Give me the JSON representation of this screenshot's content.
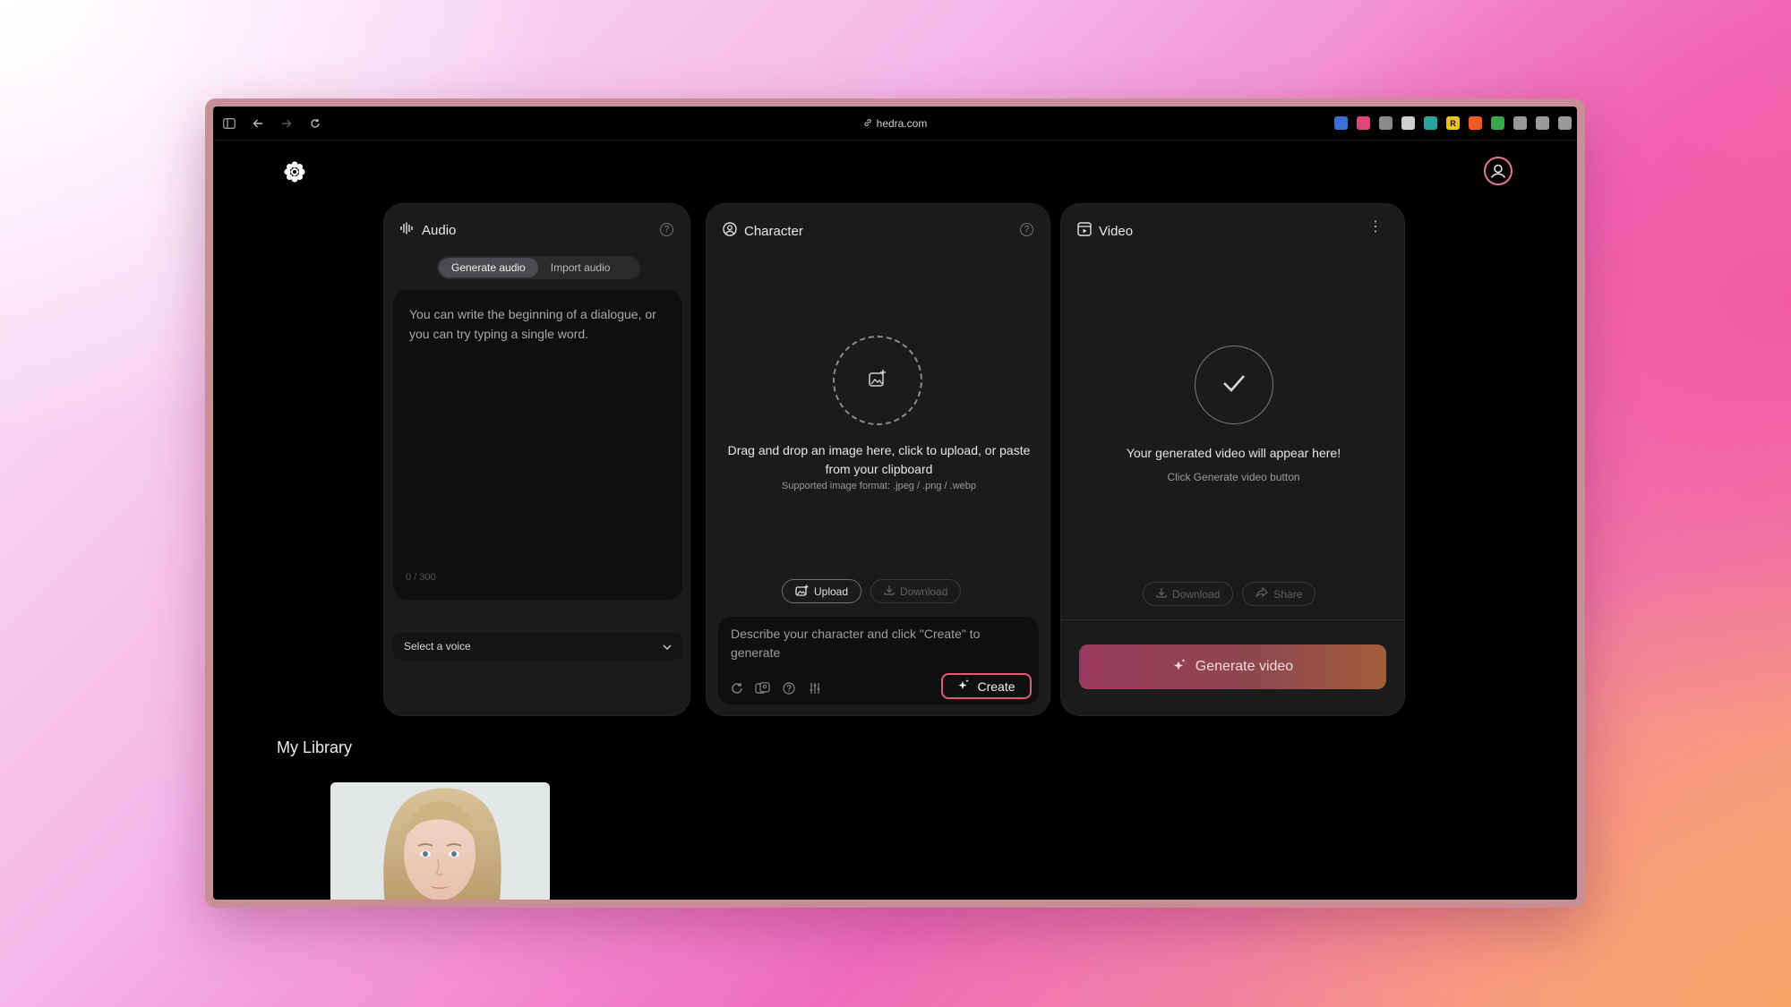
{
  "browser": {
    "url": "hedra.com",
    "extensions": [
      {
        "name": "ext-1",
        "label": "",
        "color": "#3a6fd8"
      },
      {
        "name": "ext-2",
        "label": "",
        "color": "#e0437a"
      },
      {
        "name": "ext-3",
        "label": "",
        "color": "#8a8a8a"
      },
      {
        "name": "ext-4",
        "label": "",
        "color": "#cfcfcf"
      },
      {
        "name": "ext-5",
        "label": "",
        "color": "#2aa3a0"
      },
      {
        "name": "ext-6",
        "label": "R",
        "color": "#e8c21f"
      },
      {
        "name": "ext-7",
        "label": "",
        "color": "#f05a24"
      },
      {
        "name": "ext-8",
        "label": "",
        "color": "#3aa64a"
      },
      {
        "name": "ext-9",
        "label": "",
        "color": "#9a9a9a"
      },
      {
        "name": "ext-10",
        "label": "",
        "color": "#9a9a9a"
      },
      {
        "name": "ext-11",
        "label": "",
        "color": "#9a9a9a"
      }
    ]
  },
  "audio": {
    "title": "Audio",
    "tab_generate": "Generate audio",
    "tab_import": "Import audio",
    "text_placeholder": "You can write the beginning of a dialogue, or you can try typing a single word.",
    "counter": "0 / 300",
    "voice_select": "Select a voice"
  },
  "character": {
    "title": "Character",
    "drop_text": "Drag and drop an image here, click to upload, or paste from your clipboard",
    "formats": "Supported image format: .jpeg / .png / .webp",
    "upload_label": "Upload",
    "download_label": "Download",
    "prompt_placeholder": "Describe your character and click \"Create\" to generate",
    "create_label": "Create"
  },
  "video": {
    "title": "Video",
    "empty_title": "Your generated video will appear here!",
    "empty_sub": "Click Generate video button",
    "download_label": "Download",
    "share_label": "Share",
    "generate_label": "Generate video"
  },
  "library": {
    "title": "My Library"
  },
  "colors": {
    "accent": "#e05a7c",
    "panel_bg": "#1b1b1d"
  }
}
